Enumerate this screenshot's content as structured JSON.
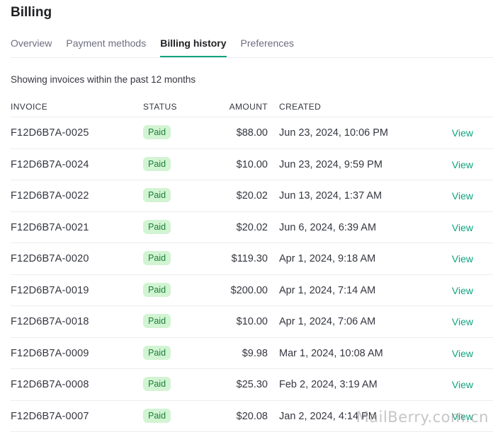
{
  "page": {
    "title": "Billing"
  },
  "tabs": [
    {
      "label": "Overview",
      "active": false
    },
    {
      "label": "Payment methods",
      "active": false
    },
    {
      "label": "Billing history",
      "active": true
    },
    {
      "label": "Preferences",
      "active": false
    }
  ],
  "subtitle": "Showing invoices within the past 12 months",
  "table": {
    "headers": {
      "invoice": "INVOICE",
      "status": "STATUS",
      "amount": "AMOUNT",
      "created": "CREATED"
    },
    "rows": [
      {
        "invoice": "F12D6B7A-0025",
        "status": "Paid",
        "amount": "$88.00",
        "created": "Jun 23, 2024, 10:06 PM",
        "action": "View"
      },
      {
        "invoice": "F12D6B7A-0024",
        "status": "Paid",
        "amount": "$10.00",
        "created": "Jun 23, 2024, 9:59 PM",
        "action": "View"
      },
      {
        "invoice": "F12D6B7A-0022",
        "status": "Paid",
        "amount": "$20.02",
        "created": "Jun 13, 2024, 1:37 AM",
        "action": "View"
      },
      {
        "invoice": "F12D6B7A-0021",
        "status": "Paid",
        "amount": "$20.02",
        "created": "Jun 6, 2024, 6:39 AM",
        "action": "View"
      },
      {
        "invoice": "F12D6B7A-0020",
        "status": "Paid",
        "amount": "$119.30",
        "created": "Apr 1, 2024, 9:18 AM",
        "action": "View"
      },
      {
        "invoice": "F12D6B7A-0019",
        "status": "Paid",
        "amount": "$200.00",
        "created": "Apr 1, 2024, 7:14 AM",
        "action": "View"
      },
      {
        "invoice": "F12D6B7A-0018",
        "status": "Paid",
        "amount": "$10.00",
        "created": "Apr 1, 2024, 7:06 AM",
        "action": "View"
      },
      {
        "invoice": "F12D6B7A-0009",
        "status": "Paid",
        "amount": "$9.98",
        "created": "Mar 1, 2024, 10:08 AM",
        "action": "View"
      },
      {
        "invoice": "F12D6B7A-0008",
        "status": "Paid",
        "amount": "$25.30",
        "created": "Feb 2, 2024, 3:19 AM",
        "action": "View"
      },
      {
        "invoice": "F12D6B7A-0007",
        "status": "Paid",
        "amount": "$20.08",
        "created": "Jan 2, 2024, 4:14 PM",
        "action": "View"
      }
    ]
  },
  "watermark": "MailBerry.com.cn",
  "colors": {
    "accent": "#10a37f",
    "badge_bg": "#d2f4d3",
    "badge_text": "#1a7f37"
  }
}
